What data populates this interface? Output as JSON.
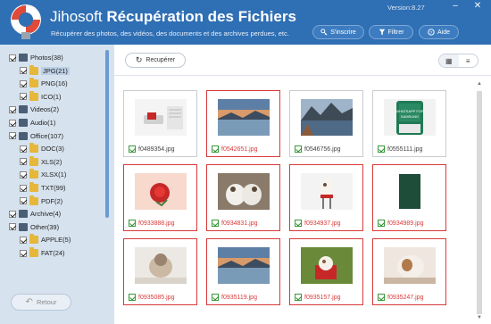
{
  "header": {
    "title_prefix": "Jihosoft",
    "title_main": "Récupération des Fichiers",
    "subtitle": "Récupérer des photos, des vidéos, des documents et des archives perdues, etc.",
    "version": "Version:8.27",
    "buttons": {
      "register": "S'inscrire",
      "filter": "Filtrer",
      "help": "Aide"
    }
  },
  "sidebar": {
    "items": [
      {
        "label": "Photos(38)",
        "icon": "photo-icon",
        "level": 0
      },
      {
        "label": "JPG(21)",
        "icon": "folder-icon",
        "level": 1,
        "selected": true
      },
      {
        "label": "PNG(16)",
        "icon": "folder-icon",
        "level": 1
      },
      {
        "label": "ICO(1)",
        "icon": "folder-icon",
        "level": 1
      },
      {
        "label": "Videos(2)",
        "icon": "video-icon",
        "level": 0
      },
      {
        "label": "Audio(1)",
        "icon": "audio-icon",
        "level": 0
      },
      {
        "label": "Office(107)",
        "icon": "office-icon",
        "level": 0
      },
      {
        "label": "DOC(3)",
        "icon": "folder-icon",
        "level": 1
      },
      {
        "label": "XLS(2)",
        "icon": "folder-icon",
        "level": 1
      },
      {
        "label": "XLSX(1)",
        "icon": "folder-icon",
        "level": 1
      },
      {
        "label": "TXT(99)",
        "icon": "folder-icon",
        "level": 1
      },
      {
        "label": "PDF(2)",
        "icon": "folder-icon",
        "level": 1
      },
      {
        "label": "Archive(4)",
        "icon": "archive-icon",
        "level": 0
      },
      {
        "label": "Other(39)",
        "icon": "other-icon",
        "level": 0
      },
      {
        "label": "APPLE(5)",
        "icon": "folder-icon",
        "level": 1
      },
      {
        "label": "FAT(24)",
        "icon": "folder-icon",
        "level": 1
      }
    ],
    "back_label": "Retour"
  },
  "toolbar": {
    "recover_label": "Recupérer"
  },
  "files": [
    {
      "name": "f0489354.jpg",
      "selected": false,
      "thumb": "usb-drive"
    },
    {
      "name": "f0542651.jpg",
      "selected": true,
      "thumb": "lake-sunset"
    },
    {
      "name": "f0546756.jpg",
      "selected": false,
      "thumb": "mountain-lake"
    },
    {
      "name": "f0555111.jpg",
      "selected": false,
      "thumb": "samsung-phone"
    },
    {
      "name": "f0933888.jpg",
      "selected": true,
      "thumb": "red-rose"
    },
    {
      "name": "f0934831.jpg",
      "selected": true,
      "thumb": "puppies-pair"
    },
    {
      "name": "f0934937.jpg",
      "selected": true,
      "thumb": "puppy-stool"
    },
    {
      "name": "f0934989.jpg",
      "selected": true,
      "thumb": "green-book"
    },
    {
      "name": "f0935085.jpg",
      "selected": true,
      "thumb": "puppy-back"
    },
    {
      "name": "f0935119.jpg",
      "selected": true,
      "thumb": "lake-sunset"
    },
    {
      "name": "f0935157.jpg",
      "selected": true,
      "thumb": "puppy-basket"
    },
    {
      "name": "f0935247.jpg",
      "selected": true,
      "thumb": "bulldog"
    }
  ],
  "colors": {
    "header": "#2f6fb4",
    "sidebar": "#d6e2ee",
    "selected": "#d93a3a",
    "check": "#2a8f2a"
  }
}
